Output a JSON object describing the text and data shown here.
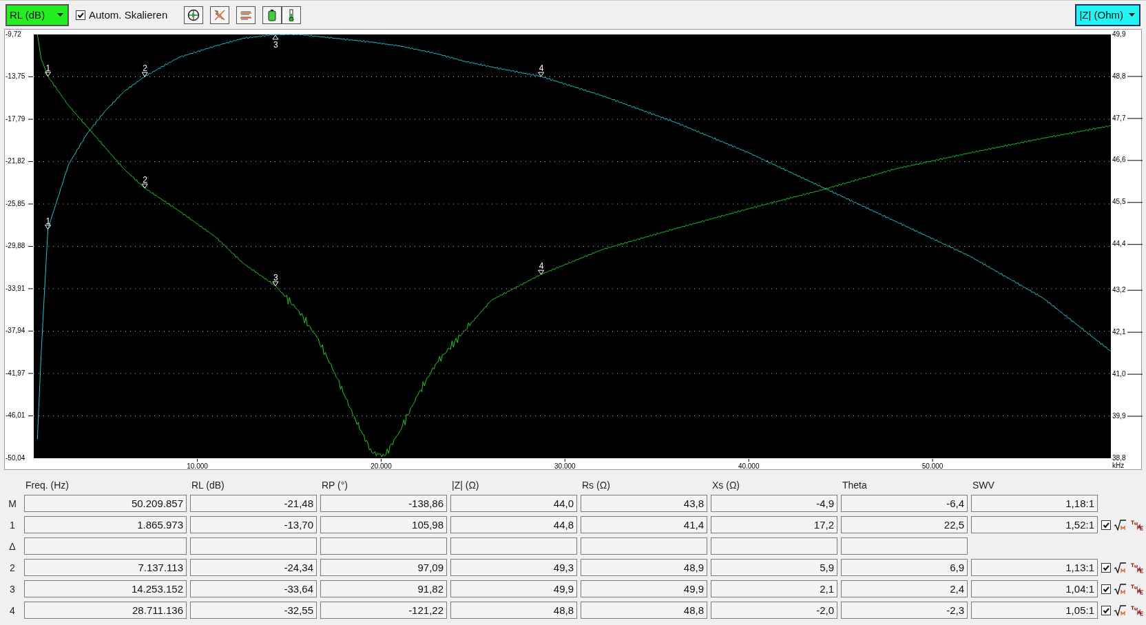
{
  "toolbar": {
    "autoscale": {
      "label": "Autom. Skalieren",
      "checked": true
    }
  },
  "chart": {
    "chart_data": {
      "type": "line",
      "xlabel": "kHz",
      "grid": true,
      "xlim": [
        1100,
        59700
      ],
      "ylim": [
        -50.04,
        -9.72
      ],
      "xticks": [
        {
          "value": 10000,
          "label": "10.000"
        },
        {
          "value": 20000,
          "label": "20.000"
        },
        {
          "value": 30000,
          "label": "30.000"
        },
        {
          "value": 40000,
          "label": "40.000"
        },
        {
          "value": 50000,
          "label": "50.000"
        }
      ],
      "yticks": [
        {
          "value": -9.72,
          "label": "-9,72"
        },
        {
          "value": -13.75,
          "label": "-13,75"
        },
        {
          "value": -17.79,
          "label": "-17,79"
        },
        {
          "value": -21.82,
          "label": "-21,82"
        },
        {
          "value": -25.85,
          "label": "-25,85"
        },
        {
          "value": -29.88,
          "label": "-29,88"
        },
        {
          "value": -33.91,
          "label": "-33,91"
        },
        {
          "value": -37.94,
          "label": "-37,94"
        },
        {
          "value": -41.97,
          "label": "-41,97"
        },
        {
          "value": -46.01,
          "label": "-46,01"
        },
        {
          "value": -50.04,
          "label": "-50,04"
        }
      ],
      "y2lim": [
        38.8,
        49.9
      ],
      "y2ticks": [
        {
          "value": 49.9,
          "label": "49,9"
        },
        {
          "value": 48.8,
          "label": "48,8"
        },
        {
          "value": 47.7,
          "label": "47,7"
        },
        {
          "value": 46.6,
          "label": "46,6"
        },
        {
          "value": 45.5,
          "label": "45,5"
        },
        {
          "value": 44.4,
          "label": "44,4"
        },
        {
          "value": 43.2,
          "label": "43,2"
        },
        {
          "value": 42.1,
          "label": "42,1"
        },
        {
          "value": 41.0,
          "label": "41,0"
        },
        {
          "value": 39.9,
          "label": "39,9"
        },
        {
          "value": 38.8,
          "label": "38,8"
        }
      ],
      "x": [
        1300,
        1500,
        1870,
        3000,
        4000,
        5000,
        6000,
        7140,
        9000,
        11000,
        12500,
        14250,
        15500,
        16500,
        17500,
        18500,
        19500,
        20200,
        21000,
        22000,
        23000,
        24500,
        26000,
        28700,
        32000,
        36000,
        40000,
        44000,
        48000,
        52000,
        56000,
        59700
      ],
      "series": [
        {
          "name": "RL (dB)",
          "color": "#22cc22",
          "values": [
            -9.72,
            -12,
            -13.7,
            -16.5,
            -18.5,
            -20.5,
            -22.5,
            -24.34,
            -26.5,
            -29,
            -31.5,
            -33.64,
            -36,
            -38.5,
            -42,
            -46,
            -49.5,
            -49.8,
            -47.5,
            -44,
            -41,
            -38,
            -35,
            -32.55,
            -30.2,
            -28.2,
            -26.3,
            -24.5,
            -22.5,
            -21,
            -19.6,
            -18.4
          ]
        },
        {
          "name": "|Z| (Ohm)",
          "color": "#22cccc",
          "axis": "y2",
          "values": [
            39.3,
            41.5,
            44.8,
            46.5,
            47.3,
            47.9,
            48.4,
            48.8,
            49.3,
            49.6,
            49.8,
            49.9,
            49.9,
            49.85,
            49.8,
            49.75,
            49.7,
            49.65,
            49.6,
            49.5,
            49.4,
            49.2,
            49.05,
            48.8,
            48.3,
            47.6,
            46.8,
            45.9,
            45,
            44.1,
            43,
            41.6
          ]
        }
      ],
      "annotations": [
        {
          "x": 1870,
          "y": -13.7,
          "text": "1"
        },
        {
          "x": 7140,
          "y": -24.34,
          "text": "2"
        },
        {
          "x": 14250,
          "y": -33.64,
          "text": "3"
        },
        {
          "x": 28700,
          "y": -32.55,
          "text": "4"
        },
        {
          "x": 1870,
          "y": -28.25,
          "text": "1"
        },
        {
          "x": 7140,
          "y": -13.72,
          "text": "2"
        },
        {
          "x": 14250,
          "y": -9.72,
          "text": "3"
        },
        {
          "x": 28700,
          "y": -13.72,
          "text": "4"
        }
      ]
    }
  },
  "table": {
    "columns": [
      "Freq. (Hz)",
      "RL (dB)",
      "RP (°)",
      "|Z| (Ω)",
      "Rs (Ω)",
      "Xs (Ω)",
      "Theta",
      "SWV"
    ],
    "rows": [
      {
        "label": "M",
        "kind": "main",
        "values": [
          "50.209.857",
          "-21,48",
          "-138,86",
          "44,0",
          "43,8",
          "-4,9",
          "-6,4",
          "1,18:1"
        ]
      },
      {
        "label": "1",
        "kind": "marker",
        "checked": true,
        "values": [
          "1.865.973",
          "-13,70",
          "105,98",
          "44,8",
          "41,4",
          "17,2",
          "22,5",
          "1,52:1"
        ]
      },
      {
        "label": "Δ",
        "kind": "delta"
      },
      {
        "label": "2",
        "kind": "marker",
        "checked": true,
        "values": [
          "7.137.113",
          "-24,34",
          "97,09",
          "49,3",
          "48,9",
          "5,9",
          "6,9",
          "1,13:1"
        ]
      },
      {
        "label": "3",
        "kind": "marker",
        "checked": true,
        "values": [
          "14.253.152",
          "-33,64",
          "91,82",
          "49,9",
          "49,9",
          "2,1",
          "2,4",
          "1,04:1"
        ]
      },
      {
        "label": "4",
        "kind": "marker",
        "checked": true,
        "values": [
          "28.711.136",
          "-32,55",
          "-121,22",
          "48,8",
          "48,8",
          "-2,0",
          "-2,3",
          "1,05:1"
        ]
      }
    ]
  }
}
